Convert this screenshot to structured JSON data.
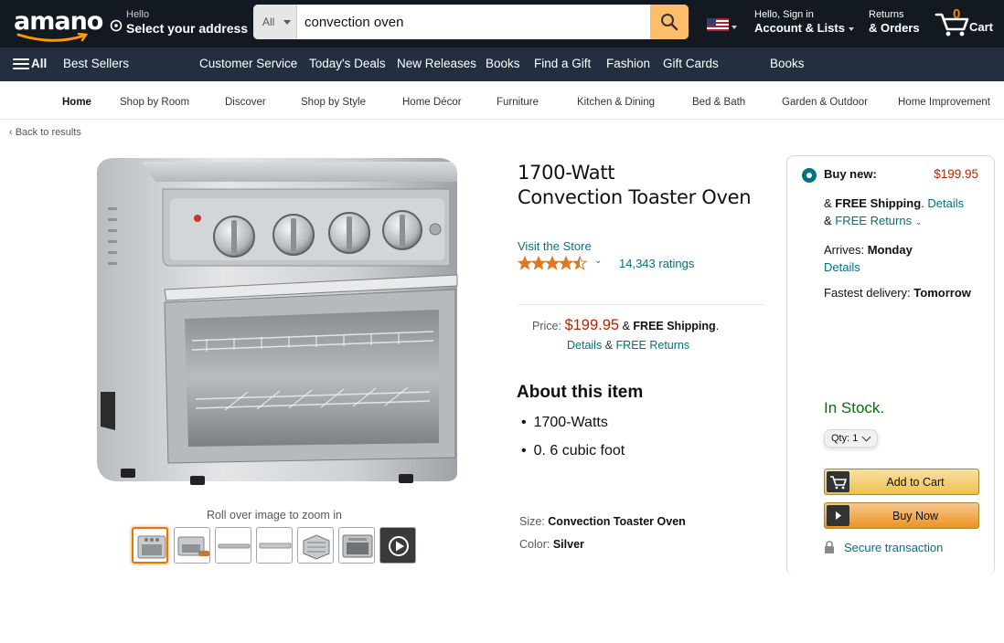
{
  "header": {
    "logo_text": "amano",
    "address_line1": "Hello",
    "address_line2": "Select your address",
    "search_category": "All",
    "search_value": "convection oven",
    "account_line1": "Hello, Sign in",
    "account_line2": "Account & Lists",
    "orders_line1": "Returns",
    "orders_line2": "& Orders",
    "cart_count": "0",
    "cart_label": "Cart"
  },
  "subnav": {
    "all_label": "All",
    "items": [
      "Best Sellers",
      "Customer Service",
      "Today's Deals",
      "New Releases",
      "Books",
      "Find a Gift",
      "Fashion",
      "Gift Cards",
      "Books"
    ]
  },
  "storenav": {
    "items": [
      "Home",
      "Shop by Room",
      "Discover",
      "Shop by Style",
      "Home Décor",
      "Furniture",
      "Kitchen & Dining",
      "Bed & Bath",
      "Garden & Outdoor",
      "Home Improvement"
    ]
  },
  "back_link": "‹ Back to results",
  "gallery": {
    "zoom_hint": "Roll over image to zoom in"
  },
  "product": {
    "title_line1": "1700-Watt",
    "title_line2": "Convection Toaster Oven",
    "store_link": "Visit the Store",
    "rating_value": 4.5,
    "ratings_count": "14,343 ratings",
    "price_label": "Price:",
    "price": "$199.95",
    "price_amp": "&",
    "free_shipping": "FREE Shipping",
    "details_link": "Details",
    "amp2": "&",
    "free_returns_link": "FREE Returns",
    "about_heading": "About this item",
    "bullets": [
      "1700-Watts",
      "0. 6 cubic foot"
    ],
    "size_label": "Size:",
    "size_value": "Convection Toaster Oven",
    "color_label": "Color:",
    "color_value": "Silver"
  },
  "buybox": {
    "buy_new_label": "Buy new:",
    "price": "$199.95",
    "amp": "&",
    "free_shipping": "FREE Shipping",
    "details_link": "Details",
    "free_returns": "FREE Returns",
    "arrives_label": "Arrives:",
    "arrives_day": "Monday",
    "arrives_details": "Details",
    "fastest_label": "Fastest delivery:",
    "fastest_day": "Tomorrow",
    "in_stock": "In Stock.",
    "qty_label": "Qty: 1",
    "add_to_cart": "Add to Cart",
    "buy_now": "Buy Now",
    "secure": "Secure transaction"
  },
  "colors": {
    "nav_dark": "#131921",
    "nav_secondary": "#232f3e",
    "link": "#007185",
    "price_red": "#b12704",
    "in_stock_green": "#007600",
    "search_button": "#febd69",
    "star": "#de7921"
  }
}
